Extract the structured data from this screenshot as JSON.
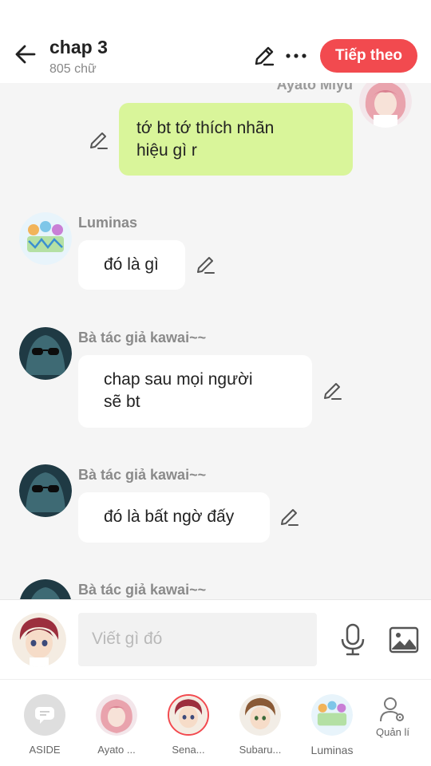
{
  "header": {
    "title": "chap 3",
    "word_count": "805 chữ",
    "next_button": "Tiếp theo",
    "accent_color": "#f24a4f"
  },
  "messages": [
    {
      "sender": "Ayato  Miyu",
      "text_lines": [
        "tớ bt tớ thích nhãn",
        "hiệu gì r"
      ],
      "side": "right",
      "avatar": "pink-hair-character"
    },
    {
      "sender": "Luminas",
      "text_lines": [
        "đó là gì"
      ],
      "side": "left",
      "avatar": "colorful-group"
    },
    {
      "sender": "Bà tác giả kawai~~",
      "text_lines": [
        "chap sau mọi người",
        "sẽ bt"
      ],
      "side": "left",
      "avatar": "dark-hooded-sunglasses"
    },
    {
      "sender": "Bà tác giả kawai~~",
      "text_lines": [
        "đó là bất ngờ đấy"
      ],
      "side": "left",
      "avatar": "dark-hooded-sunglasses"
    },
    {
      "sender": "Bà tác giả kawai~~",
      "text_lines": [],
      "side": "left",
      "avatar": "dark-hooded-sunglasses"
    }
  ],
  "input": {
    "placeholder": "Viết gì đó"
  },
  "bottom_nav": [
    {
      "label": "ASIDE",
      "icon": "chat-bubble-icon"
    },
    {
      "label": "Ayato ...",
      "icon": "pink-hair-avatar"
    },
    {
      "label": "Sena...",
      "icon": "red-hair-avatar"
    },
    {
      "label": "Subaru...",
      "icon": "brown-hair-avatar"
    },
    {
      "label": "Luminas",
      "icon": "colorful-group-avatar"
    },
    {
      "label": "Quản lí",
      "icon": "user-settings-icon"
    }
  ]
}
